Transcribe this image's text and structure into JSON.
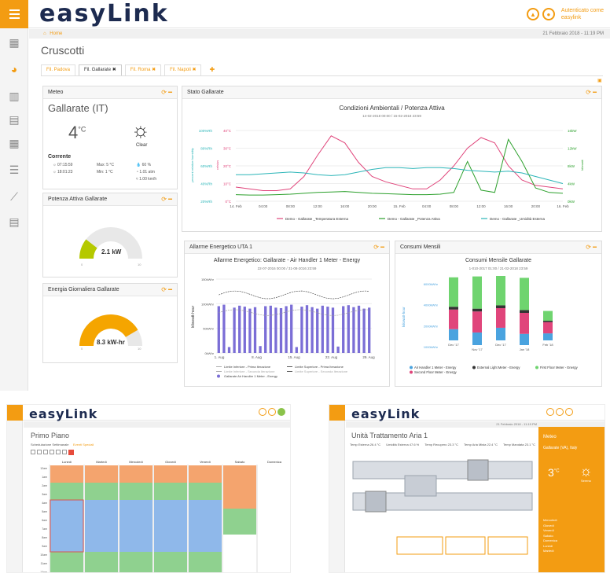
{
  "app": {
    "logo": "easyLink",
    "home": "Home",
    "datetime": "21 Febbraio 2018 - 11:19 PM",
    "user_line1": "Autenticato come",
    "user_line2": "easylink"
  },
  "page": {
    "title": "Cruscotti",
    "tabs": [
      {
        "label": "Fil. Padova"
      },
      {
        "label": "Fil. Gallarate ✖"
      },
      {
        "label": "Fil. Roma ✖"
      },
      {
        "label": "Fil. Napoli ✖"
      },
      {
        "label": "✚"
      }
    ]
  },
  "meteo": {
    "title": "Meteo",
    "city": "Gallarate (IT)",
    "temp": "4",
    "unit": "°C",
    "condition": "Clear",
    "current_label": "Corrente",
    "sunrise": "07:15:59",
    "sunset": "18:01:23",
    "max": "Max: 5 °C",
    "min": "Min: 1 °C",
    "humidity": "60 %",
    "pressure": "1.01 atm",
    "wind": "1.00 km/h"
  },
  "potenza": {
    "title": "Potenza Attiva Gallarate",
    "value": "2.1 kW",
    "min": "0",
    "max": "10",
    "fraction": 0.21
  },
  "energia": {
    "title": "Energia Giornaliera Gallarate",
    "value": "8.3 kW-hr",
    "min": "0",
    "max": "10",
    "fraction": 0.83
  },
  "stato": {
    "title": "Stato Gallarate"
  },
  "allarme": {
    "title": "Allarme Energetico UTA 1"
  },
  "consumi": {
    "title": "Consumi Mensili"
  },
  "chart_data": [
    {
      "type": "line",
      "title": "Condizioni Ambientali / Potenza Attiva",
      "subtitle": "14-02-2018 00:00 / 15-02-2018 23:59",
      "x": [
        "14. Feb",
        "04:00",
        "08:00",
        "12:00",
        "16:00",
        "20:00",
        "15. Feb",
        "04:00",
        "08:00",
        "12:00",
        "16:00",
        "20:00",
        "16. Feb"
      ],
      "y_left_ticks": [
        "100%Rh",
        "80%Rh",
        "60%Rh",
        "40%Rh",
        "20%Rh"
      ],
      "y_temp_ticks": [
        "40°C",
        "30°C",
        "20°C",
        "10°C",
        "0°C"
      ],
      "y_right_ticks": [
        "16kW",
        "12kW",
        "8kW",
        "4kW",
        "0kW"
      ],
      "ylabel_left": "percent relative humidity",
      "ylabel_temp": "celsius",
      "ylabel_right": "kilowatt",
      "series": [
        {
          "name": "Demo - Gallarate _Temperatura Esterna",
          "color": "#e0457b",
          "values": [
            8,
            7,
            6,
            6,
            7,
            14,
            26,
            37,
            33,
            22,
            14,
            11,
            9,
            7,
            7,
            12,
            20,
            30,
            36,
            33,
            20,
            12,
            9,
            8,
            7
          ]
        },
        {
          "name": "Demo - Gallarate _Potenza Attiva",
          "color": "#2ca02c",
          "values": [
            1.5,
            1.4,
            1.4,
            1.5,
            1.6,
            1.8,
            2.0,
            2.1,
            2.2,
            2.0,
            1.8,
            1.7,
            1.6,
            1.5,
            1.5,
            1.6,
            2.0,
            9.0,
            2.5,
            2.0,
            14,
            9,
            3,
            2,
            1.8
          ]
        },
        {
          "name": "Demo - Gallarate _Umidità Esterna",
          "color": "#2bb5b8",
          "values": [
            50,
            50,
            51,
            52,
            53,
            52,
            50,
            49,
            50,
            53,
            56,
            58,
            58,
            57,
            58,
            58,
            57,
            55,
            54,
            53,
            54,
            52,
            48,
            44,
            40
          ]
        }
      ]
    },
    {
      "type": "bar",
      "title": "Allarme Energetico: Gallarate - Air Handler 1 Meter - Energy",
      "subtitle": "22-07-2016 00:00 / 31-08-2016 23:59",
      "x_ticks": [
        "1. Aug",
        "8. Aug",
        "15. Aug",
        "22. Aug",
        "29. Aug"
      ],
      "y_ticks": [
        "150kWhr",
        "100kWhr",
        "50kWhr",
        "0kWhr"
      ],
      "ylabel": "kilowatt-hour",
      "values": [
        95,
        98,
        12,
        92,
        96,
        94,
        90,
        93,
        14,
        95,
        96,
        92,
        91,
        95,
        98,
        12,
        94,
        97,
        93,
        90,
        96,
        94,
        92,
        13,
        95,
        97,
        93,
        96,
        90,
        92
      ],
      "series": [
        {
          "name": "Limite Inferiore - Prima Iterazione"
        },
        {
          "name": "Limite Superiore - Prima Iterazione"
        },
        {
          "name": "Limite Inferiore - Seconda Iterazione"
        },
        {
          "name": "Limite Superiore - Seconda Iterazione"
        },
        {
          "name": "Gallarate Air Handler 1 Meter - Energy"
        }
      ]
    },
    {
      "type": "bar",
      "title": "Consumi Mensile Gallarate",
      "subtitle": "1-010-2017 01:00 / 21-02-2018 23:59",
      "categories": [
        "Dec '17",
        "Nov '17",
        "Dec '17",
        "Jan '18",
        "Feb '18"
      ],
      "y_ticks": [
        "6000kWhr",
        "4000kWhr",
        "2000kWhr",
        "1000kWhr"
      ],
      "ylabel": "kilowatt-hour",
      "series": [
        {
          "name": "Air Handler 1 Meter - Energy",
          "color": "#4aa3df",
          "values": [
            800,
            900,
            900,
            800,
            500
          ]
        },
        {
          "name": "External Light Meter - Energy",
          "color": "#333333",
          "values": [
            200,
            200,
            200,
            200,
            100
          ]
        },
        {
          "name": "First Floor Meter - Energy",
          "color": "#6fd46f",
          "values": [
            2100,
            2300,
            2100,
            2300,
            700
          ]
        },
        {
          "name": "Second Floor Meter - Energy",
          "color": "#e0457b",
          "values": [
            1400,
            1500,
            1400,
            1500,
            800
          ]
        }
      ]
    }
  ],
  "shot2": {
    "logo": "easyLink",
    "title": "Primo Piano",
    "tab1": "Schedulazione Settimanale",
    "tab2": "Eventi Speciali",
    "days": [
      "Lunedì",
      "Martedì",
      "Mercoledì",
      "Giovedì",
      "Venerdì",
      "Sabato",
      "Domenica"
    ],
    "hours": [
      "12am",
      "1am",
      "2am",
      "3am",
      "4am",
      "5am",
      "6am",
      "7am",
      "8am",
      "9am",
      "10am",
      "11am",
      "12pm"
    ]
  },
  "shot3": {
    "logo": "easyLink",
    "title": "Unità Trattamento Aria 1",
    "meteo": "Meteo",
    "city": "Gallarate (VA), Italy",
    "temp": "3",
    "unit": "°C",
    "condition": "Sereno",
    "date": "21 Febbraio 2018 - 11:19 PM",
    "readings": [
      "Temp Esterna 26.4 °C",
      "Umidità Esterna 47.6 %",
      "Temp Recupero 23.3 °C",
      "Temp Aria Mista 22.4 °C",
      "Temp Mandata 23.1 °C"
    ],
    "days": [
      "Mercoledì",
      "Giovedì",
      "Venerdì",
      "Sabato",
      "Domenica",
      "Lunedì",
      "Martedì"
    ]
  }
}
